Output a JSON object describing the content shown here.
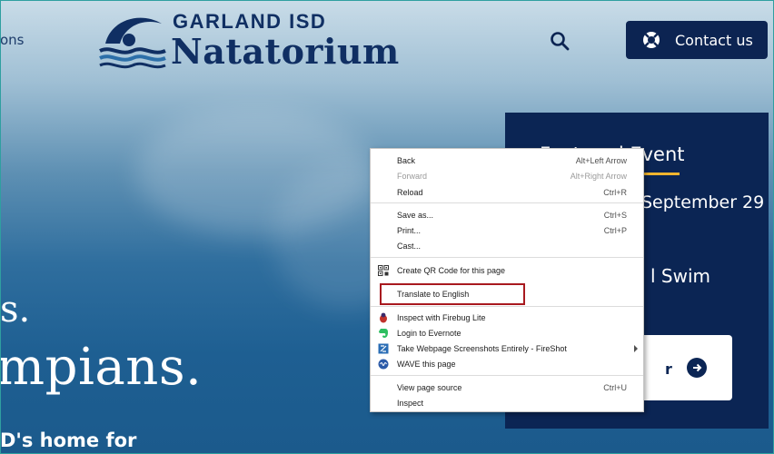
{
  "header": {
    "nav_fragment": "ons",
    "logo": {
      "line1": "GARLAND ISD",
      "line2": "Natatorium"
    },
    "contact_label": "Contact us"
  },
  "hero": {
    "line_fragment": "s.",
    "title_fragment": "mpians.",
    "subtitle_fragment": "D's home for"
  },
  "featured": {
    "heading": "Featured Event",
    "date_fragment": "September 29",
    "event_fragment": "l Swim",
    "button_fragment": "r"
  },
  "context_menu": {
    "items": [
      {
        "label": "Back",
        "shortcut": "Alt+Left Arrow"
      },
      {
        "label": "Forward",
        "shortcut": "Alt+Right Arrow",
        "disabled": true
      },
      {
        "label": "Reload",
        "shortcut": "Ctrl+R"
      },
      {
        "label": "Save as...",
        "shortcut": "Ctrl+S"
      },
      {
        "label": "Print...",
        "shortcut": "Ctrl+P"
      },
      {
        "label": "Cast..."
      },
      {
        "label": "Create QR Code for this page",
        "icon": "qr-code-icon"
      },
      {
        "label": "Translate to English"
      },
      {
        "label": "Inspect with Firebug Lite",
        "icon": "firebug-icon"
      },
      {
        "label": "Login to Evernote",
        "icon": "evernote-icon"
      },
      {
        "label": "Take Webpage Screenshots Entirely - FireShot",
        "icon": "fireshot-icon"
      },
      {
        "label": "WAVE this page",
        "icon": "wave-icon"
      },
      {
        "label": "View page source",
        "shortcut": "Ctrl+U"
      },
      {
        "label": "Inspect"
      }
    ]
  },
  "colors": {
    "navy": "#0b2554",
    "accent_gold": "#f1b52e",
    "highlight_red": "#a8191f"
  }
}
